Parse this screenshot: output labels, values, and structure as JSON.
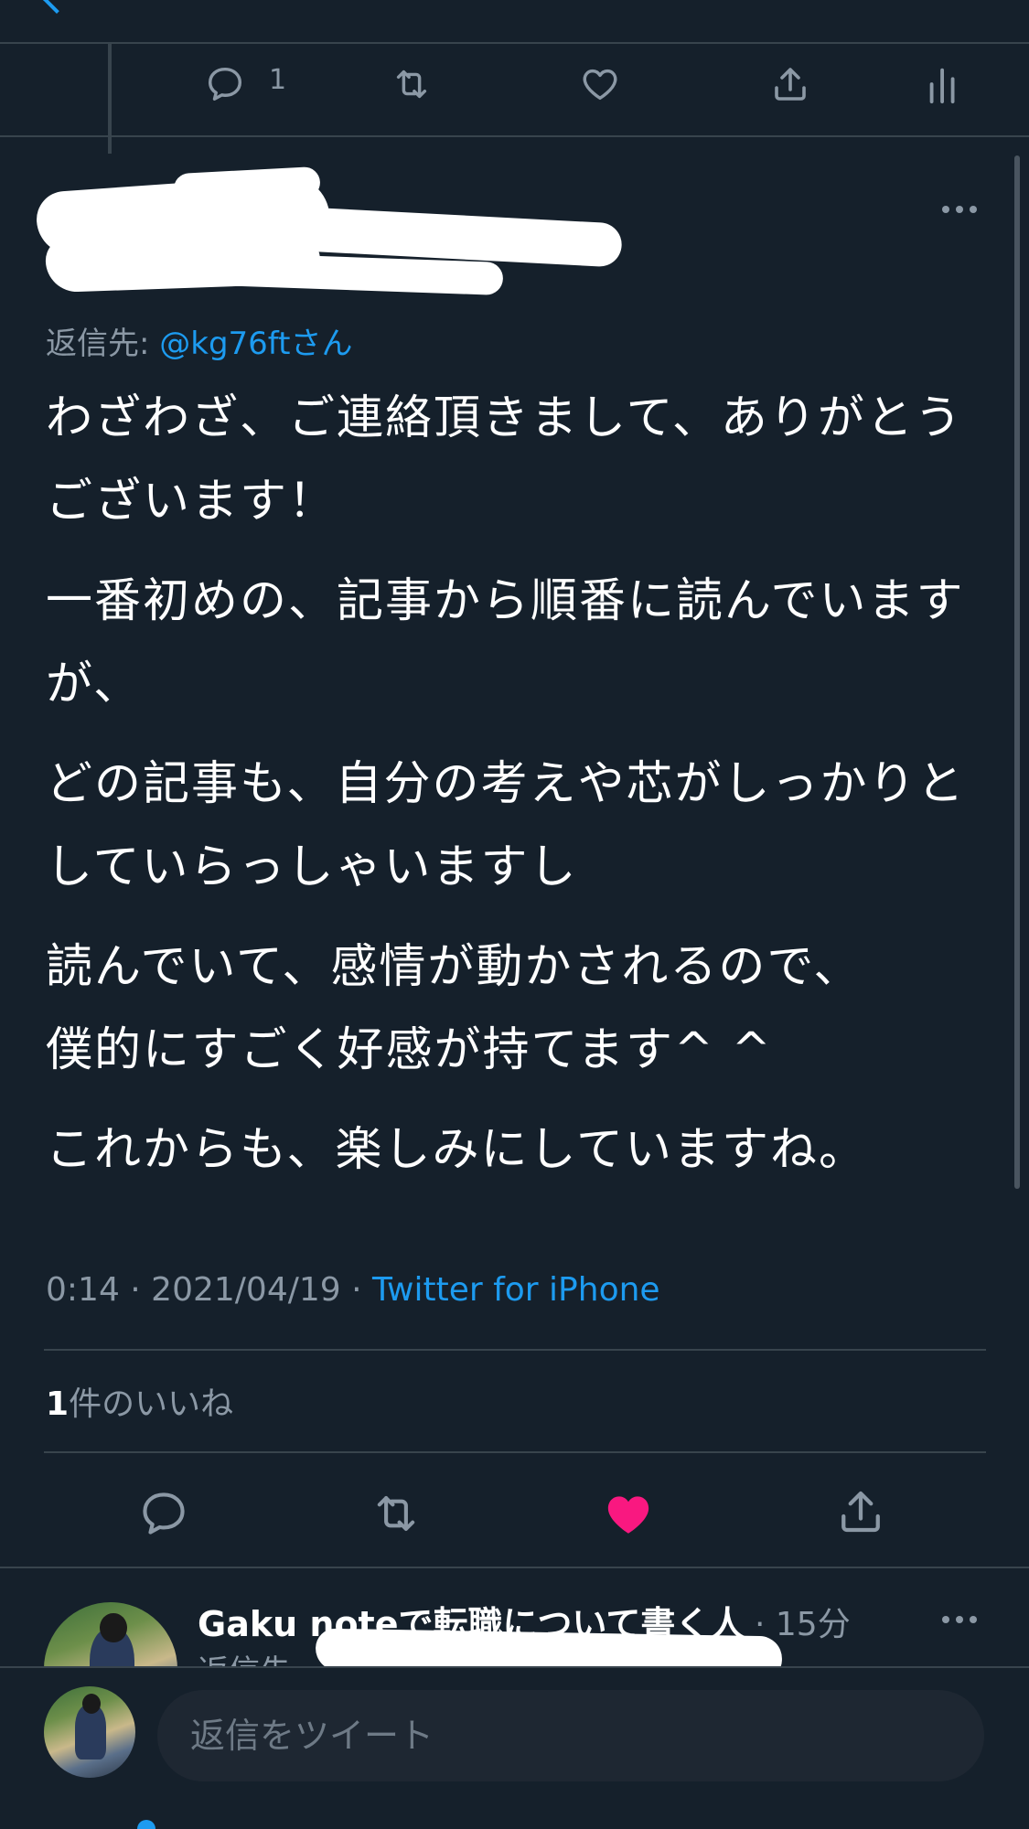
{
  "colors": {
    "background": "#15202b",
    "accent": "#1d9bf0",
    "muted": "#8b98a5",
    "divider": "#38444d",
    "like_active": "#f91880"
  },
  "parent_tweet": {
    "actions": {
      "reply_icon": "reply-icon",
      "reply_count": "1",
      "retweet_icon": "retweet-icon",
      "like_icon": "heart-icon",
      "share_icon": "share-icon",
      "analytics_icon": "analytics-icon"
    }
  },
  "tweet": {
    "reply_to_label": "返信先: ",
    "reply_to_handle": "@kg76ftさん",
    "body": [
      "わざわざ、ご連絡頂きまして、ありがとうございます！",
      "一番初めの、記事から順番に読んでいますが、",
      "どの記事も、自分の考えや芯がしっかりとしていらっしゃいますし",
      "読んでいて、感情が動かされるので、\n僕的にすごく好感が持てます^ ^",
      "これからも、楽しみにしていますね。"
    ],
    "timestamp": "0:14 · 2021/04/19 · ",
    "source": "Twitter for iPhone",
    "likes_count": "1",
    "likes_label": "件のいいね",
    "more_icon": "more-icon",
    "liked": true
  },
  "next_reply": {
    "author": "Gaku noteで転職について書く人",
    "time": " · 15分",
    "sub_prefix": "返信先"
  },
  "composer": {
    "placeholder": "返信をツイート"
  }
}
